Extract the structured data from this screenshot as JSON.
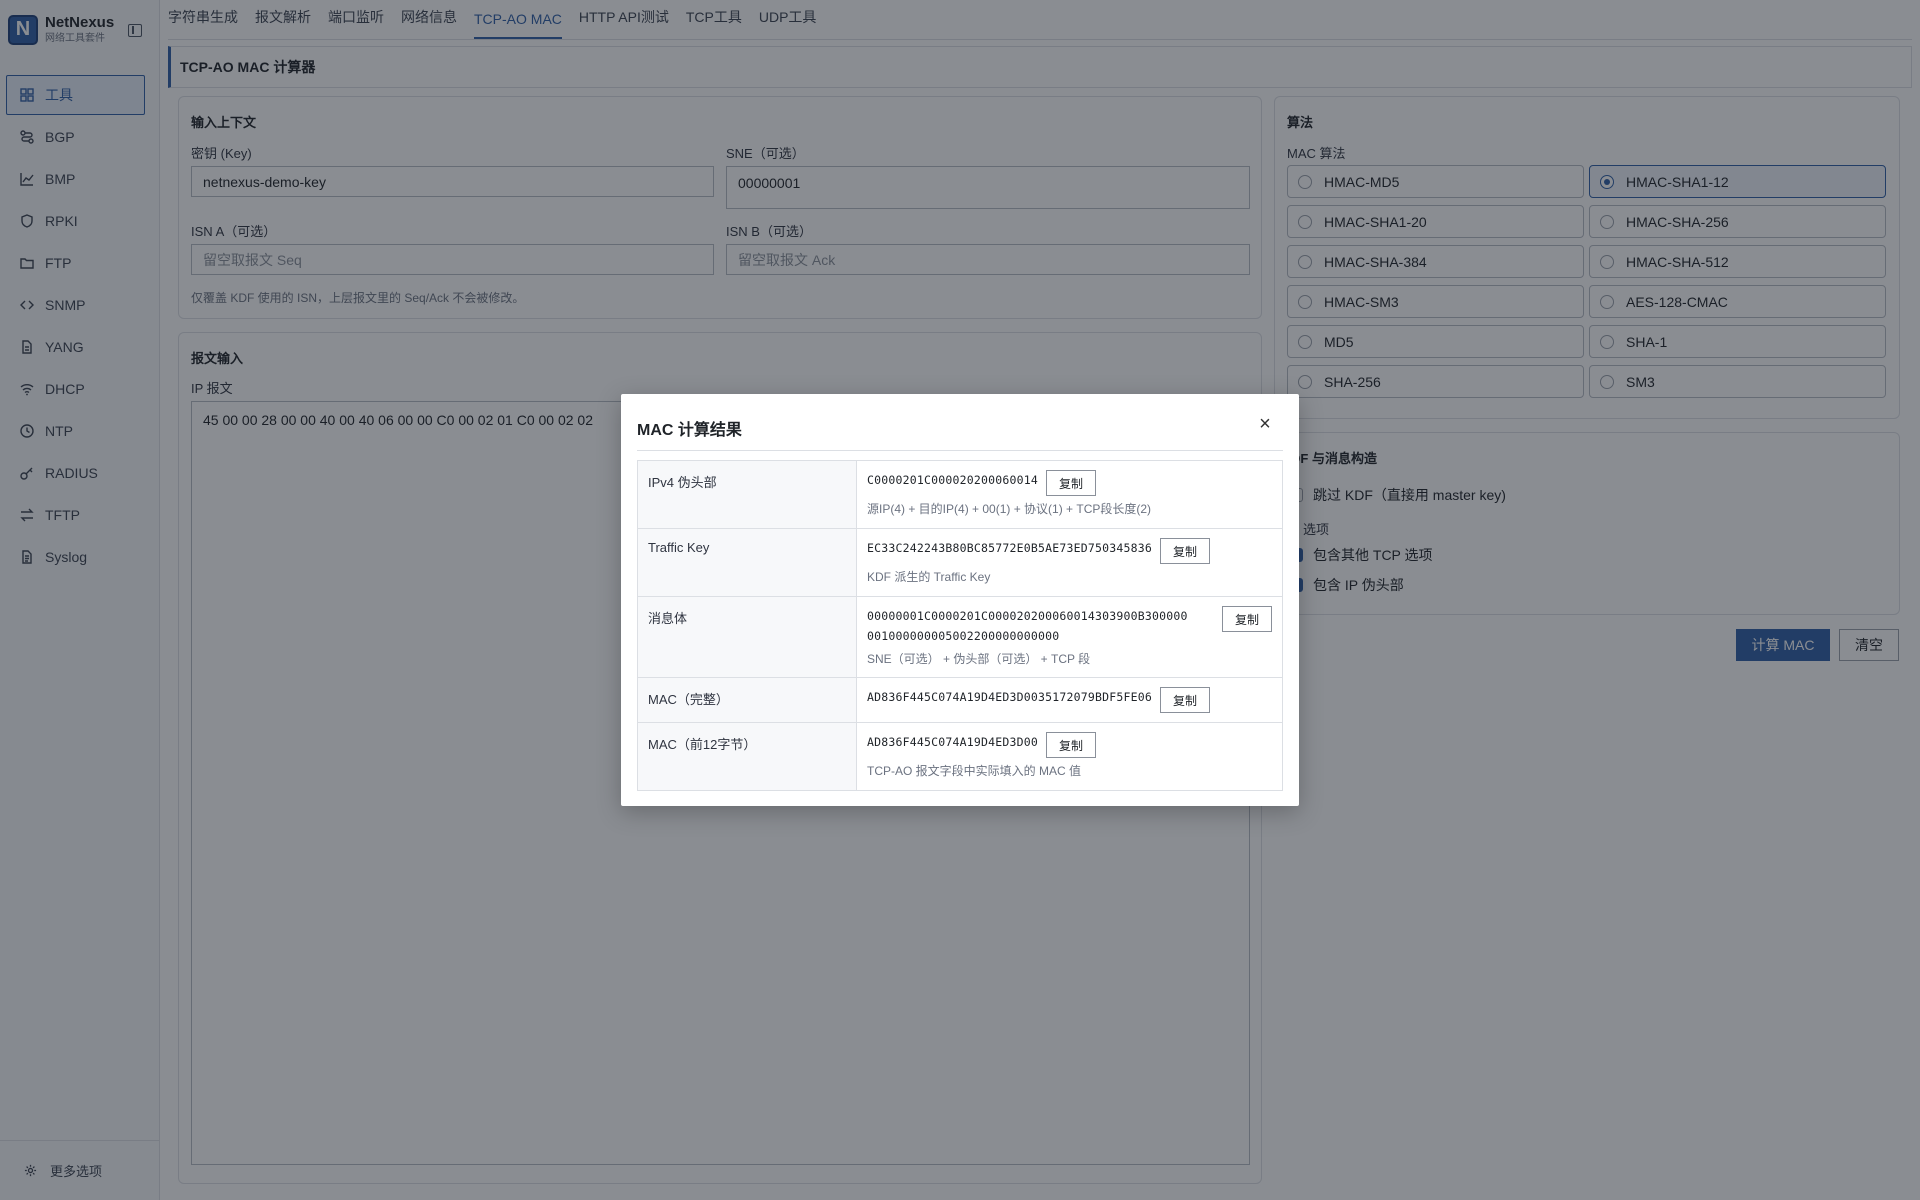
{
  "brand": {
    "name": "NetNexus",
    "subtitle": "网络工具套件",
    "logo_letter": "N"
  },
  "sidebar": {
    "items": [
      {
        "label": "工具",
        "icon": "grid-icon"
      },
      {
        "label": "BGP",
        "icon": "route-icon"
      },
      {
        "label": "BMP",
        "icon": "chart-icon"
      },
      {
        "label": "RPKI",
        "icon": "shield-icon"
      },
      {
        "label": "FTP",
        "icon": "folder-icon"
      },
      {
        "label": "SNMP",
        "icon": "code-icon"
      },
      {
        "label": "YANG",
        "icon": "file-icon"
      },
      {
        "label": "DHCP",
        "icon": "wifi-icon"
      },
      {
        "label": "NTP",
        "icon": "clock-icon"
      },
      {
        "label": "RADIUS",
        "icon": "key-icon"
      },
      {
        "label": "TFTP",
        "icon": "swap-icon"
      },
      {
        "label": "Syslog",
        "icon": "doc-icon"
      }
    ],
    "more": "更多选项"
  },
  "tabs": [
    "字符串生成",
    "报文解析",
    "端口监听",
    "网络信息",
    "TCP-AO MAC",
    "HTTP API测试",
    "TCP工具",
    "UDP工具"
  ],
  "page_title": "TCP-AO MAC 计算器",
  "context": {
    "title": "输入上下文",
    "key_label": "密钥 (Key)",
    "key_value": "netnexus-demo-key",
    "sne_label": "SNE（可选）",
    "sne_value": "00000001",
    "isn_a_label": "ISN A（可选）",
    "isn_a_placeholder": "留空取报文 Seq",
    "isn_b_label": "ISN B（可选）",
    "isn_b_placeholder": "留空取报文 Ack",
    "hint": "仅覆盖 KDF 使用的 ISN，上层报文里的 Seq/Ack 不会被修改。"
  },
  "packet": {
    "title": "报文输入",
    "ip_label": "IP 报文",
    "ip_value": "45 00 00 28 00 00 40 00 40 06 00 00 C0 00 02 01 C0 00 02 02"
  },
  "algorithm": {
    "title": "算法",
    "mac_label": "MAC 算法",
    "options": [
      "HMAC-MD5",
      "HMAC-SHA1-12",
      "HMAC-SHA1-20",
      "HMAC-SHA-256",
      "HMAC-SHA-384",
      "HMAC-SHA-512",
      "HMAC-SM3",
      "AES-128-CMAC",
      "MD5",
      "SHA-1",
      "SHA-256",
      "SM3"
    ],
    "selected": "HMAC-SHA1-12"
  },
  "kdf": {
    "title": "DF 与消息构造",
    "skip_kdf": "跳过 KDF（直接用 master key)",
    "tcp_options_label": "P 选项",
    "include_tcp": "包含其他 TCP 选项",
    "include_ip": "包含 IP 伪头部"
  },
  "actions": {
    "compute": "计算 MAC",
    "clear": "清空"
  },
  "modal": {
    "title": "MAC 计算结果",
    "copy_label": "复制",
    "rows": [
      {
        "key": "IPv4 伪头部",
        "value": "C0000201C000020200060014",
        "note": "源IP(4) + 目的IP(4) + 00(1) + 协议(1) + TCP段长度(2)"
      },
      {
        "key": "Traffic Key",
        "value": "EC33C242243B80BC85772E0B5AE73ED750345836",
        "note": "KDF 派生的 Traffic Key"
      },
      {
        "key": "消息体",
        "value": "00000001C0000201C000020200060014303900B300000001000000005002200000000000",
        "value_line1": "00000001C0000201C000020200060014303900B300000",
        "value_line2": "001000000005002200000000000",
        "note": "SNE（可选） + 伪头部（可选） + TCP 段"
      },
      {
        "key": "MAC（完整）",
        "value": "AD836F445C074A19D4ED3D0035172079BDF5FE06",
        "note": ""
      },
      {
        "key": "MAC（前12字节）",
        "value": "AD836F445C074A19D4ED3D00",
        "note": "TCP-AO 报文字段中实际填入的 MAC 值"
      }
    ]
  }
}
